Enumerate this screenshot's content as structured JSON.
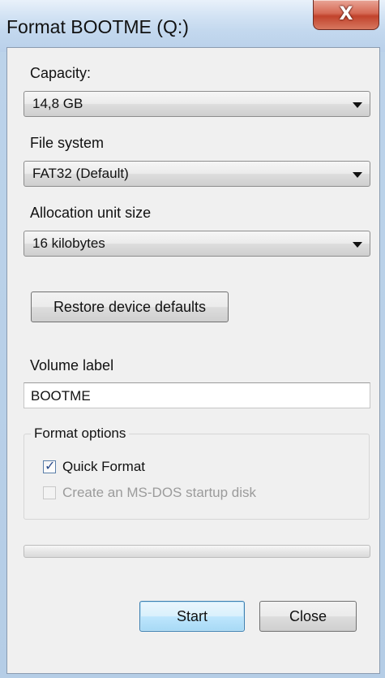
{
  "window": {
    "title": "Format BOOTME (Q:)",
    "close_glyph": "X"
  },
  "capacity": {
    "label": "Capacity:",
    "value": "14,8 GB"
  },
  "file_system": {
    "label": "File system",
    "value": "FAT32 (Default)"
  },
  "allocation": {
    "label": "Allocation unit size",
    "value": "16 kilobytes"
  },
  "restore_button": {
    "label": "Restore device defaults"
  },
  "volume": {
    "label": "Volume label",
    "value": "BOOTME"
  },
  "format_options": {
    "legend": "Format options",
    "quick_format": {
      "label": "Quick Format",
      "checked": true,
      "enabled": true
    },
    "msdos_disk": {
      "label": "Create an MS-DOS startup disk",
      "checked": false,
      "enabled": false
    }
  },
  "progress": {
    "value": 0
  },
  "buttons": {
    "start": "Start",
    "close": "Close"
  },
  "colors": {
    "accent": "#3c7fb1",
    "close_red": "#c1432c"
  }
}
